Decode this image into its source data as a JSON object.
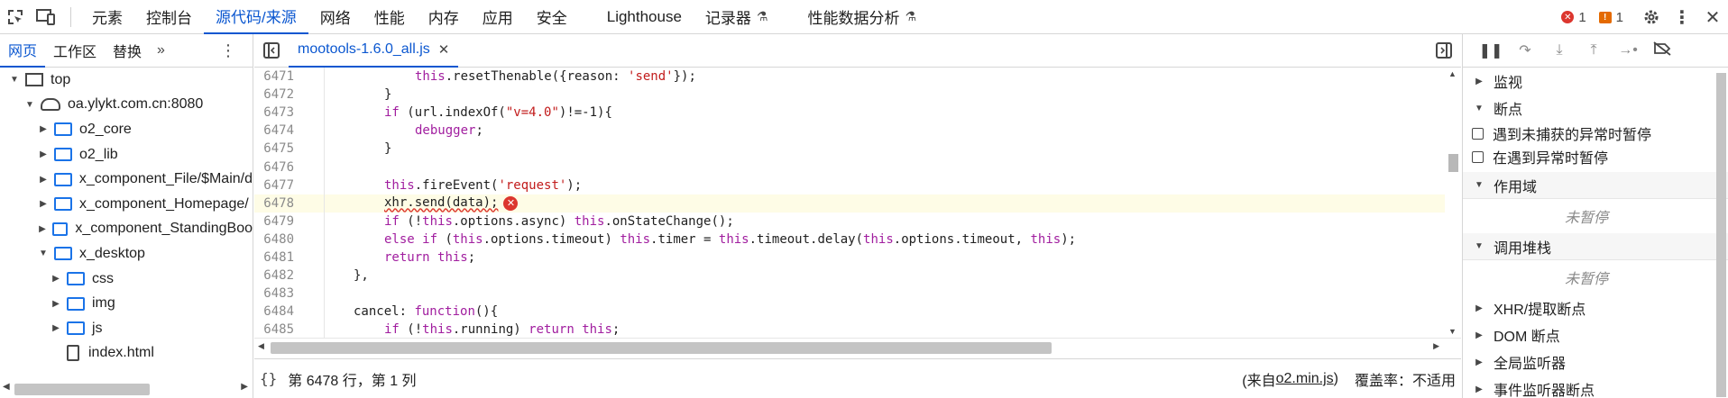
{
  "toolbar": {
    "tabs": [
      "元素",
      "控制台",
      "源代码/来源",
      "网络",
      "性能",
      "内存",
      "应用",
      "安全",
      "Lighthouse",
      "记录器",
      "性能数据分析"
    ],
    "error_count": "1",
    "warning_count": "1"
  },
  "navigator": {
    "tabs": [
      "网页",
      "工作区",
      "替换"
    ],
    "more": "»",
    "tree": [
      {
        "label": "top",
        "icon": "frame",
        "depth": 0,
        "arrow": "▼"
      },
      {
        "label": "oa.ylykt.com.cn:8080",
        "icon": "cloud",
        "depth": 1,
        "arrow": "▼"
      },
      {
        "label": "o2_core",
        "icon": "folder",
        "depth": 2,
        "arrow": "▶"
      },
      {
        "label": "o2_lib",
        "icon": "folder",
        "depth": 2,
        "arrow": "▶"
      },
      {
        "label": "x_component_File/$Main/d",
        "icon": "folder",
        "depth": 2,
        "arrow": "▶"
      },
      {
        "label": "x_component_Homepage/",
        "icon": "folder",
        "depth": 2,
        "arrow": "▶"
      },
      {
        "label": "x_component_StandingBoo",
        "icon": "folder",
        "depth": 2,
        "arrow": "▶"
      },
      {
        "label": "x_desktop",
        "icon": "folder",
        "depth": 2,
        "arrow": "▼"
      },
      {
        "label": "css",
        "icon": "folder",
        "depth": 3,
        "arrow": "▶"
      },
      {
        "label": "img",
        "icon": "folder",
        "depth": 3,
        "arrow": "▶"
      },
      {
        "label": "js",
        "icon": "folder",
        "depth": 3,
        "arrow": "▶"
      },
      {
        "label": "index.html",
        "icon": "file",
        "depth": 3,
        "arrow": ""
      }
    ]
  },
  "editor": {
    "file_tab": "mootools-1.6.0_all.js",
    "highlight_line": "6478",
    "lines": [
      {
        "n": "6471",
        "indent": 3,
        "code": "this.resetThenable({reason: 'send'});"
      },
      {
        "n": "6472",
        "indent": 2,
        "code": "}"
      },
      {
        "n": "6473",
        "indent": 2,
        "code": "if (url.indexOf(\"v=4.0\")!=-1){"
      },
      {
        "n": "6474",
        "indent": 3,
        "code": "debugger;"
      },
      {
        "n": "6475",
        "indent": 2,
        "code": "}"
      },
      {
        "n": "6476",
        "indent": 0,
        "code": ""
      },
      {
        "n": "6477",
        "indent": 2,
        "code": "this.fireEvent('request');"
      },
      {
        "n": "6478",
        "indent": 2,
        "code": "xhr.send(data);"
      },
      {
        "n": "6479",
        "indent": 2,
        "code": "if (!this.options.async) this.onStateChange();"
      },
      {
        "n": "6480",
        "indent": 2,
        "code": "else if (this.options.timeout) this.timer = this.timeout.delay(this.options.timeout, this);"
      },
      {
        "n": "6481",
        "indent": 2,
        "code": "return this;"
      },
      {
        "n": "6482",
        "indent": 1,
        "code": "},"
      },
      {
        "n": "6483",
        "indent": 0,
        "code": ""
      },
      {
        "n": "6484",
        "indent": 1,
        "code": "cancel: function(){"
      },
      {
        "n": "6485",
        "indent": 2,
        "code": "if (!this.running) return this;"
      }
    ],
    "status_position": "第 6478 行，第 1 列",
    "status_source_prefix": "(来自 ",
    "status_source_link": "o2.min.js",
    "status_source_suffix": ")",
    "status_coverage": "覆盖率：不适用"
  },
  "debugger": {
    "watch": "监视",
    "breakpoints": "断点",
    "pause_uncaught": "遇到未捕获的异常时暂停",
    "pause_caught": "在遇到异常时暂停",
    "scope": "作用域",
    "not_paused_1": "未暂停",
    "call_stack": "调用堆栈",
    "not_paused_2": "未暂停",
    "xhr_breakpoints": "XHR/提取断点",
    "dom_breakpoints": "DOM 断点",
    "global_listeners": "全局监听器",
    "event_listener_breakpoints": "事件监听器断点"
  },
  "colors": {
    "accent": "#0b57d0",
    "error": "#dc362e",
    "warning": "#e46a00",
    "keyword": "#a11e9f",
    "string": "#c21b1b"
  }
}
